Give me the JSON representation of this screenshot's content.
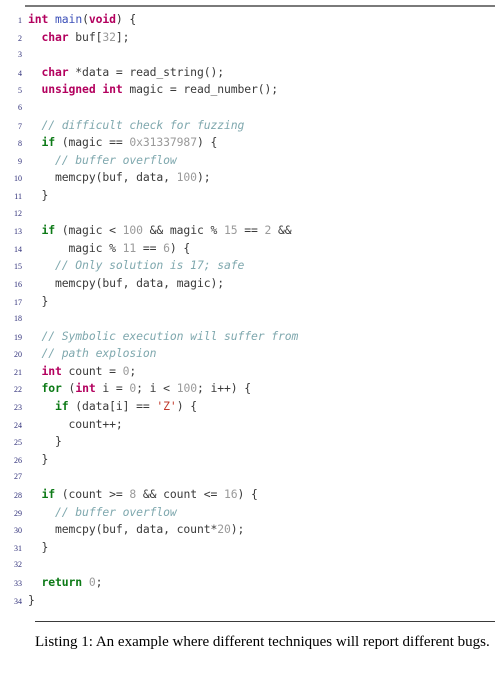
{
  "figure": {
    "kind": "code-listing",
    "language": "C",
    "rule_color": "#7a7a7a",
    "rule_bottom_color": "#3a3a3a"
  },
  "palette": {
    "keyword_type": "#b3005e",
    "keyword_control": "#0c7a16",
    "function_name": "#3b4fb8",
    "number_literal": "#9a9a9a",
    "char_literal": "#c0392b",
    "comment": "#7fa8ae",
    "plain_text": "#333333",
    "line_number": "#30307a",
    "background": "#ffffff"
  },
  "caption": {
    "label": "Listing 1:",
    "text": " An example where different techniques will report different bugs."
  },
  "code": {
    "lines": [
      {
        "n": "1",
        "tokens": [
          {
            "t": "int",
            "c": "kw-type"
          },
          {
            "t": " ",
            "c": "plain"
          },
          {
            "t": "main",
            "c": "fn"
          },
          {
            "t": "(",
            "c": "punc"
          },
          {
            "t": "void",
            "c": "kw-type"
          },
          {
            "t": ") {",
            "c": "punc"
          }
        ]
      },
      {
        "n": "2",
        "tokens": [
          {
            "t": "  ",
            "c": "plain"
          },
          {
            "t": "char",
            "c": "kw-type"
          },
          {
            "t": " buf[",
            "c": "plain"
          },
          {
            "t": "32",
            "c": "num"
          },
          {
            "t": "];",
            "c": "plain"
          }
        ]
      },
      {
        "n": "3",
        "tokens": []
      },
      {
        "n": "4",
        "tokens": [
          {
            "t": "  ",
            "c": "plain"
          },
          {
            "t": "char",
            "c": "kw-type"
          },
          {
            "t": " *data = read_string();",
            "c": "plain"
          }
        ]
      },
      {
        "n": "5",
        "tokens": [
          {
            "t": "  ",
            "c": "plain"
          },
          {
            "t": "unsigned int",
            "c": "kw-type"
          },
          {
            "t": " magic = read_number();",
            "c": "plain"
          }
        ]
      },
      {
        "n": "6",
        "tokens": []
      },
      {
        "n": "7",
        "tokens": [
          {
            "t": "  ",
            "c": "plain"
          },
          {
            "t": "// difficult check for fuzzing",
            "c": "cmt"
          }
        ]
      },
      {
        "n": "8",
        "tokens": [
          {
            "t": "  ",
            "c": "plain"
          },
          {
            "t": "if",
            "c": "kw-ctrl"
          },
          {
            "t": " (magic == ",
            "c": "plain"
          },
          {
            "t": "0x31337987",
            "c": "num"
          },
          {
            "t": ") {",
            "c": "plain"
          }
        ]
      },
      {
        "n": "9",
        "tokens": [
          {
            "t": "    ",
            "c": "plain"
          },
          {
            "t": "// buffer overflow",
            "c": "cmt"
          }
        ]
      },
      {
        "n": "10",
        "tokens": [
          {
            "t": "    memcpy(buf, data, ",
            "c": "plain"
          },
          {
            "t": "100",
            "c": "num"
          },
          {
            "t": ");",
            "c": "plain"
          }
        ]
      },
      {
        "n": "11",
        "tokens": [
          {
            "t": "  }",
            "c": "plain"
          }
        ]
      },
      {
        "n": "12",
        "tokens": []
      },
      {
        "n": "13",
        "tokens": [
          {
            "t": "  ",
            "c": "plain"
          },
          {
            "t": "if",
            "c": "kw-ctrl"
          },
          {
            "t": " (magic < ",
            "c": "plain"
          },
          {
            "t": "100",
            "c": "num"
          },
          {
            "t": " && magic % ",
            "c": "plain"
          },
          {
            "t": "15",
            "c": "num"
          },
          {
            "t": " == ",
            "c": "plain"
          },
          {
            "t": "2",
            "c": "num"
          },
          {
            "t": " &&",
            "c": "plain"
          }
        ]
      },
      {
        "n": "14",
        "tokens": [
          {
            "t": "      magic % ",
            "c": "plain"
          },
          {
            "t": "11",
            "c": "num"
          },
          {
            "t": " == ",
            "c": "plain"
          },
          {
            "t": "6",
            "c": "num"
          },
          {
            "t": ") {",
            "c": "plain"
          }
        ]
      },
      {
        "n": "15",
        "tokens": [
          {
            "t": "    ",
            "c": "plain"
          },
          {
            "t": "// Only solution is 17; safe",
            "c": "cmt"
          }
        ]
      },
      {
        "n": "16",
        "tokens": [
          {
            "t": "    memcpy(buf, data, magic);",
            "c": "plain"
          }
        ]
      },
      {
        "n": "17",
        "tokens": [
          {
            "t": "  }",
            "c": "plain"
          }
        ]
      },
      {
        "n": "18",
        "tokens": []
      },
      {
        "n": "19",
        "tokens": [
          {
            "t": "  ",
            "c": "plain"
          },
          {
            "t": "// Symbolic execution will suffer from",
            "c": "cmt"
          }
        ]
      },
      {
        "n": "20",
        "tokens": [
          {
            "t": "  ",
            "c": "plain"
          },
          {
            "t": "// path explosion",
            "c": "cmt"
          }
        ]
      },
      {
        "n": "21",
        "tokens": [
          {
            "t": "  ",
            "c": "plain"
          },
          {
            "t": "int",
            "c": "kw-type"
          },
          {
            "t": " count = ",
            "c": "plain"
          },
          {
            "t": "0",
            "c": "num"
          },
          {
            "t": ";",
            "c": "plain"
          }
        ]
      },
      {
        "n": "22",
        "tokens": [
          {
            "t": "  ",
            "c": "plain"
          },
          {
            "t": "for",
            "c": "kw-ctrl"
          },
          {
            "t": " (",
            "c": "plain"
          },
          {
            "t": "int",
            "c": "kw-type"
          },
          {
            "t": " i = ",
            "c": "plain"
          },
          {
            "t": "0",
            "c": "num"
          },
          {
            "t": "; i < ",
            "c": "plain"
          },
          {
            "t": "100",
            "c": "num"
          },
          {
            "t": "; i++) {",
            "c": "plain"
          }
        ]
      },
      {
        "n": "23",
        "tokens": [
          {
            "t": "    ",
            "c": "plain"
          },
          {
            "t": "if",
            "c": "kw-ctrl"
          },
          {
            "t": " (data[i] == ",
            "c": "plain"
          },
          {
            "t": "'Z'",
            "c": "chr"
          },
          {
            "t": ") {",
            "c": "plain"
          }
        ]
      },
      {
        "n": "24",
        "tokens": [
          {
            "t": "      count++;",
            "c": "plain"
          }
        ]
      },
      {
        "n": "25",
        "tokens": [
          {
            "t": "    }",
            "c": "plain"
          }
        ]
      },
      {
        "n": "26",
        "tokens": [
          {
            "t": "  }",
            "c": "plain"
          }
        ]
      },
      {
        "n": "27",
        "tokens": []
      },
      {
        "n": "28",
        "tokens": [
          {
            "t": "  ",
            "c": "plain"
          },
          {
            "t": "if",
            "c": "kw-ctrl"
          },
          {
            "t": " (count >= ",
            "c": "plain"
          },
          {
            "t": "8",
            "c": "num"
          },
          {
            "t": " && count <= ",
            "c": "plain"
          },
          {
            "t": "16",
            "c": "num"
          },
          {
            "t": ") {",
            "c": "plain"
          }
        ]
      },
      {
        "n": "29",
        "tokens": [
          {
            "t": "    ",
            "c": "plain"
          },
          {
            "t": "// buffer overflow",
            "c": "cmt"
          }
        ]
      },
      {
        "n": "30",
        "tokens": [
          {
            "t": "    memcpy(buf, data, count*",
            "c": "plain"
          },
          {
            "t": "20",
            "c": "num"
          },
          {
            "t": ");",
            "c": "plain"
          }
        ]
      },
      {
        "n": "31",
        "tokens": [
          {
            "t": "  }",
            "c": "plain"
          }
        ]
      },
      {
        "n": "32",
        "tokens": []
      },
      {
        "n": "33",
        "tokens": [
          {
            "t": "  ",
            "c": "plain"
          },
          {
            "t": "return",
            "c": "kw-ctrl"
          },
          {
            "t": " ",
            "c": "plain"
          },
          {
            "t": "0",
            "c": "num"
          },
          {
            "t": ";",
            "c": "plain"
          }
        ]
      },
      {
        "n": "34",
        "tokens": [
          {
            "t": "}",
            "c": "plain"
          }
        ]
      }
    ]
  }
}
